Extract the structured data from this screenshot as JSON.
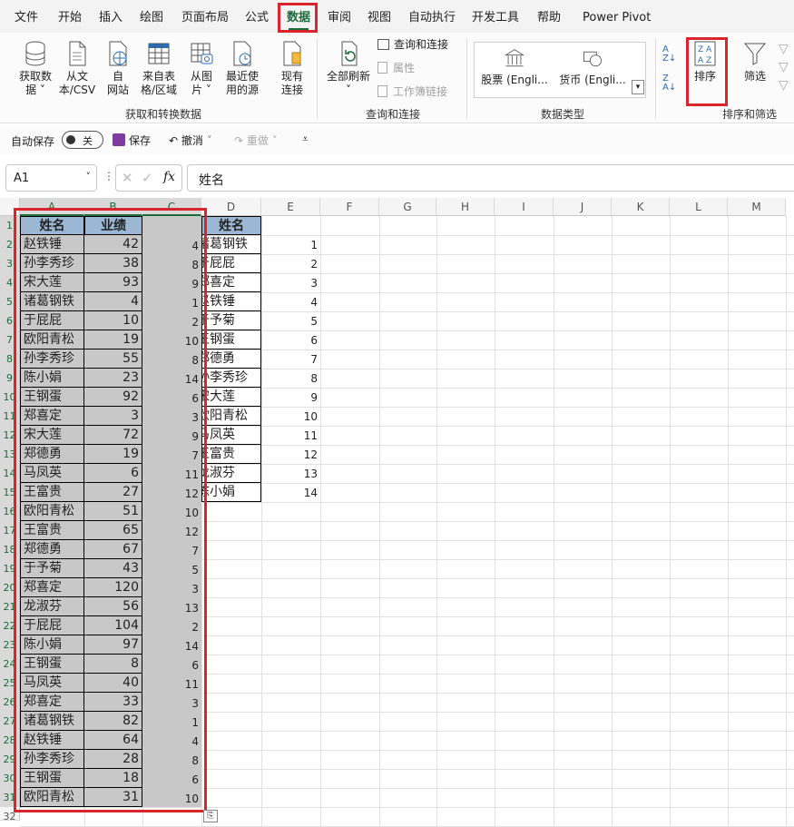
{
  "tabs": [
    "文件",
    "开始",
    "插入",
    "绘图",
    "页面布局",
    "公式",
    "数据",
    "审阅",
    "视图",
    "自动执行",
    "开发工具",
    "帮助",
    "Power Pivot"
  ],
  "active_tab": "数据",
  "ribbon": {
    "get_data": "获取数\n据 ˅",
    "from_csv": "从文\n本/CSV",
    "from_web": "自\n网站",
    "from_table": "来自表\n格/区域",
    "from_picture": "从图\n片 ˅",
    "recent_sources": "最近使\n用的源",
    "existing_connections": "现有\n连接",
    "group_get_transform": "获取和转换数据",
    "refresh_all": "全部刷新\n˅",
    "queries_connections": "查询和连接",
    "properties": "属性",
    "edit_links": "工作簿链接",
    "group_queries": "查询和连接",
    "stocks": "股票 (Engli...",
    "currency": "货币 (Engli...",
    "group_data_types": "数据类型",
    "sort": "排序",
    "filter": "筛选",
    "group_sort_filter": "排序和筛选"
  },
  "qat": {
    "autosave": "自动保存",
    "toggle": "关",
    "save": "保存",
    "undo": "撤消",
    "redo": "重做"
  },
  "formula_bar": {
    "name_box": "A1",
    "fx": "fx",
    "content": "姓名"
  },
  "columns": [
    "A",
    "B",
    "C",
    "D",
    "E",
    "F",
    "G",
    "H",
    "I",
    "J",
    "K",
    "L",
    "M"
  ],
  "table_a": {
    "headers": [
      "姓名",
      "业绩"
    ],
    "rows": [
      [
        "赵铁锤",
        "42",
        "4"
      ],
      [
        "孙李秀珍",
        "38",
        "8"
      ],
      [
        "宋大莲",
        "93",
        "9"
      ],
      [
        "诸葛钢铁",
        "4",
        "1"
      ],
      [
        "于屁屁",
        "10",
        "2"
      ],
      [
        "欧阳青松",
        "19",
        "10"
      ],
      [
        "孙李秀珍",
        "55",
        "8"
      ],
      [
        "陈小娟",
        "23",
        "14"
      ],
      [
        "王钢蛋",
        "92",
        "6"
      ],
      [
        "郑喜定",
        "3",
        "3"
      ],
      [
        "宋大莲",
        "72",
        "9"
      ],
      [
        "郑德勇",
        "19",
        "7"
      ],
      [
        "马凤英",
        "6",
        "11"
      ],
      [
        "王富贵",
        "27",
        "12"
      ],
      [
        "欧阳青松",
        "51",
        "10"
      ],
      [
        "王富贵",
        "65",
        "12"
      ],
      [
        "郑德勇",
        "67",
        "7"
      ],
      [
        "于予菊",
        "43",
        "5"
      ],
      [
        "郑喜定",
        "120",
        "3"
      ],
      [
        "龙淑芬",
        "56",
        "13"
      ],
      [
        "于屁屁",
        "104",
        "2"
      ],
      [
        "陈小娟",
        "97",
        "14"
      ],
      [
        "王钢蛋",
        "8",
        "6"
      ],
      [
        "马凤英",
        "40",
        "11"
      ],
      [
        "郑喜定",
        "33",
        "3"
      ],
      [
        "诸葛钢铁",
        "82",
        "1"
      ],
      [
        "赵铁锤",
        "64",
        "4"
      ],
      [
        "孙李秀珍",
        "28",
        "8"
      ],
      [
        "王钢蛋",
        "18",
        "6"
      ],
      [
        "欧阳青松",
        "31",
        "10"
      ]
    ]
  },
  "table_d": {
    "header": "姓名",
    "rows": [
      [
        "诸葛钢铁",
        "1"
      ],
      [
        "于屁屁",
        "2"
      ],
      [
        "郑喜定",
        "3"
      ],
      [
        "赵铁锤",
        "4"
      ],
      [
        "于予菊",
        "5"
      ],
      [
        "王钢蛋",
        "6"
      ],
      [
        "郑德勇",
        "7"
      ],
      [
        "孙李秀珍",
        "8"
      ],
      [
        "宋大莲",
        "9"
      ],
      [
        "欧阳青松",
        "10"
      ],
      [
        "马凤英",
        "11"
      ],
      [
        "王富贵",
        "12"
      ],
      [
        "龙淑芬",
        "13"
      ],
      [
        "陈小娟",
        "14"
      ]
    ]
  },
  "colors": {
    "accent": "#1e6b3a",
    "highlight": "#d9252b",
    "header_fill": "#9bb7d4",
    "selection_fill": "#c8c8c8"
  }
}
